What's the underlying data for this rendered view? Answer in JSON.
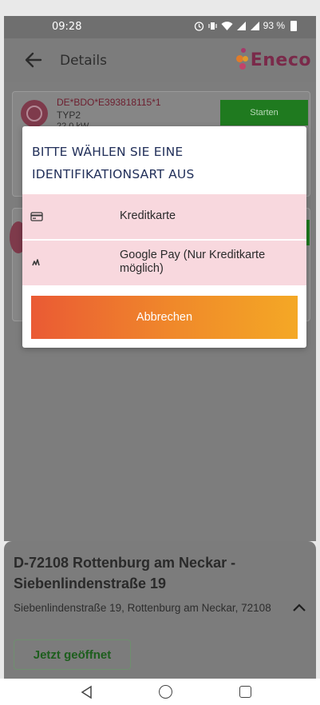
{
  "status_bar": {
    "time": "09:28",
    "battery": "93 %",
    "icons": [
      "alarm-icon",
      "vibrate-icon",
      "wifi-icon",
      "signal-icon",
      "signal-icon",
      "battery-icon"
    ]
  },
  "header": {
    "back_icon": "arrow-left-icon",
    "title": "Details",
    "logo_text": "Eneco"
  },
  "background_cards": [
    {
      "id": "DE*BDO*E393818115*1",
      "type": "TYP2",
      "power": "22,0 kW",
      "button": "Starten"
    }
  ],
  "modal": {
    "title": "BITTE WÄHLEN SIE EINE IDENTIFIKATIONSART AUS",
    "options": [
      {
        "icon": "credit-card-icon",
        "label": "Kreditkarte"
      },
      {
        "icon": "google-pay-icon",
        "label": "Google Pay (Nur Kreditkarte möglich)"
      }
    ],
    "cancel_label": "Abbrechen"
  },
  "location": {
    "title": "D-72108 Rottenburg am Neckar - Siebenlindenstraße 19",
    "address": "Siebenlindenstraße 19, Rottenburg am Neckar, 72108",
    "status_button": "Jetzt geöffnet",
    "expand_icon": "chevron-up-icon"
  },
  "nav_bar": {
    "icons": [
      "back-triangle-icon",
      "home-circle-icon",
      "recent-square-icon"
    ]
  },
  "colors": {
    "brand": "#7a2a4a",
    "start_green": "#2ca52c",
    "option_bg": "#f8d8de",
    "cancel_gradient_start": "#ea5a34",
    "cancel_gradient_end": "#f4a825",
    "title_blue": "#22305a"
  }
}
